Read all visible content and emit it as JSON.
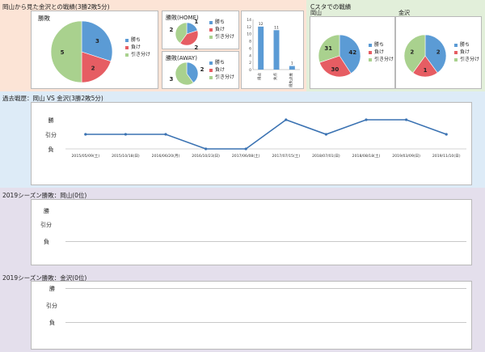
{
  "sections": {
    "top_left_title": "岡山から見た金沢との戦績(3勝2敗5分)",
    "top_right_title": "Cスタでの戦績",
    "history_title": "過去戦歴：岡山 VS 金沢(3勝2敗5分)",
    "season1_title": "2019シーズン勝敗：岡山(0位)",
    "season2_title": "2019シーズン勝敗：金沢(0位)"
  },
  "colors": {
    "top_bg": "#fce4d6",
    "right_bg": "#e2efda",
    "history_bg": "#ddebf7",
    "season_bg": "#e4dfec",
    "win": "#5b9bd5",
    "loss": "#e65d63",
    "draw": "#a9d18e",
    "line": "#3a72b2"
  },
  "legend": {
    "win": "勝ち",
    "loss": "負け",
    "draw": "引き分け"
  },
  "pies": {
    "overall": {
      "label": "勝敗",
      "win": 3,
      "loss": 2,
      "draw": 5
    },
    "home": {
      "label": "勝敗(HOME)",
      "win": 1,
      "loss": 2,
      "draw": 2
    },
    "away": {
      "label": "勝敗(AWAY)",
      "win": 2,
      "loss": 0,
      "draw": 3
    },
    "okayama": {
      "label": "岡山",
      "win": 42,
      "loss": 30,
      "draw": 31
    },
    "kanazawa": {
      "label": "金沢",
      "win": 2,
      "loss": 1,
      "draw": 2
    }
  },
  "chart_data": [
    {
      "type": "bar",
      "categories": [
        "得点",
        "失点",
        "得失点差"
      ],
      "values": [
        12,
        11,
        1
      ],
      "ylim": [
        0,
        14
      ],
      "yticks": [
        "0",
        "2",
        "4",
        "6",
        "8",
        "10",
        "12",
        "14"
      ]
    },
    {
      "type": "line",
      "categories": [
        "2015/05/09(土)",
        "2015/10/18(日)",
        "2016/06/20(月)",
        "2016/10/23(日)",
        "2017/06/08(土)",
        "2017/07/15(土)",
        "2018/07/01(日)",
        "2018/08/18(土)",
        "2019/03/09(日)",
        "2019/11/10(日)"
      ],
      "values": [
        0,
        0,
        0,
        -1,
        -1,
        1,
        0,
        1,
        1,
        0
      ],
      "yticks": [
        "勝",
        "引分",
        "負"
      ]
    }
  ],
  "season": {
    "rows": [
      "勝",
      "引分",
      "負"
    ]
  }
}
